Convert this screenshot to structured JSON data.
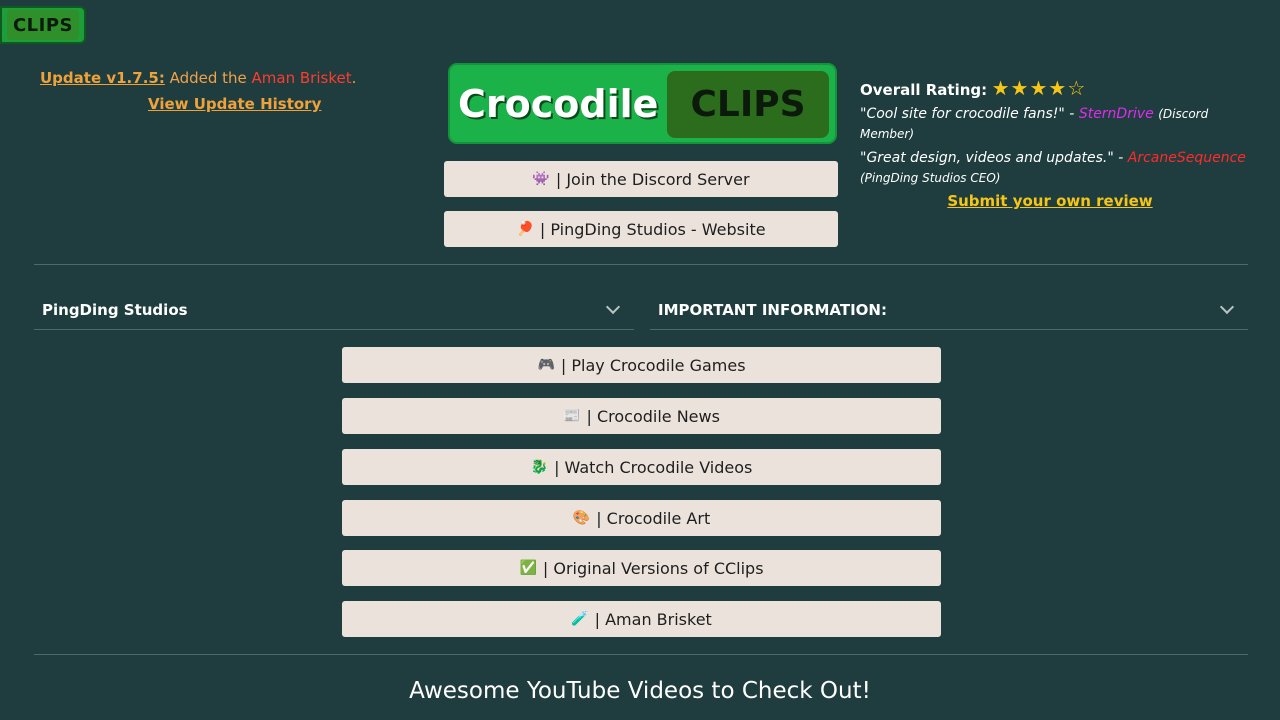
{
  "corner_logo": "CLIPS",
  "update": {
    "version_link": "Update v1.7.5:",
    "text_before": " Added the ",
    "highlight": "Aman Brisket",
    "text_after": ".",
    "history_link": "View Update History"
  },
  "logo": {
    "word": "Crocodile",
    "clips": "CLIPS"
  },
  "top_buttons": [
    {
      "icon": "👾",
      "label": "| Join the Discord Server"
    },
    {
      "icon": "🏓",
      "label": "| PingDing Studios - Website"
    }
  ],
  "rating": {
    "label": "Overall Rating:",
    "stars": "★★★★☆",
    "reviews": [
      {
        "quote": "\"Cool site for crocodile fans!\" - ",
        "name": "SternDrive",
        "role": "(Discord Member)"
      },
      {
        "quote": "\"Great design, videos and updates.\" - ",
        "name": "ArcaneSequence",
        "role": "(PingDing Studios CEO)"
      }
    ],
    "submit_link": "Submit your own review"
  },
  "sections": {
    "left": "PingDing Studios",
    "right": "IMPORTANT INFORMATION:"
  },
  "menu_buttons": [
    {
      "icon": "🎮",
      "label": "| Play Crocodile Games"
    },
    {
      "icon": "📰",
      "label": "| Crocodile News"
    },
    {
      "icon": "🐉",
      "label": "| Watch Crocodile Videos"
    },
    {
      "icon": "🎨",
      "label": "| Crocodile Art"
    },
    {
      "icon": "✅",
      "label": "| Original Versions of CClips"
    },
    {
      "icon": "🧪",
      "label": "| Aman Brisket"
    }
  ],
  "bottom_title": "Awesome YouTube Videos to Check Out!",
  "colors": {
    "background": "#1f3d3e",
    "button_bg": "#ebe3db",
    "accent_orange": "#f0a23a",
    "accent_yellow": "#f5c518",
    "logo_green": "#1bb24a"
  }
}
